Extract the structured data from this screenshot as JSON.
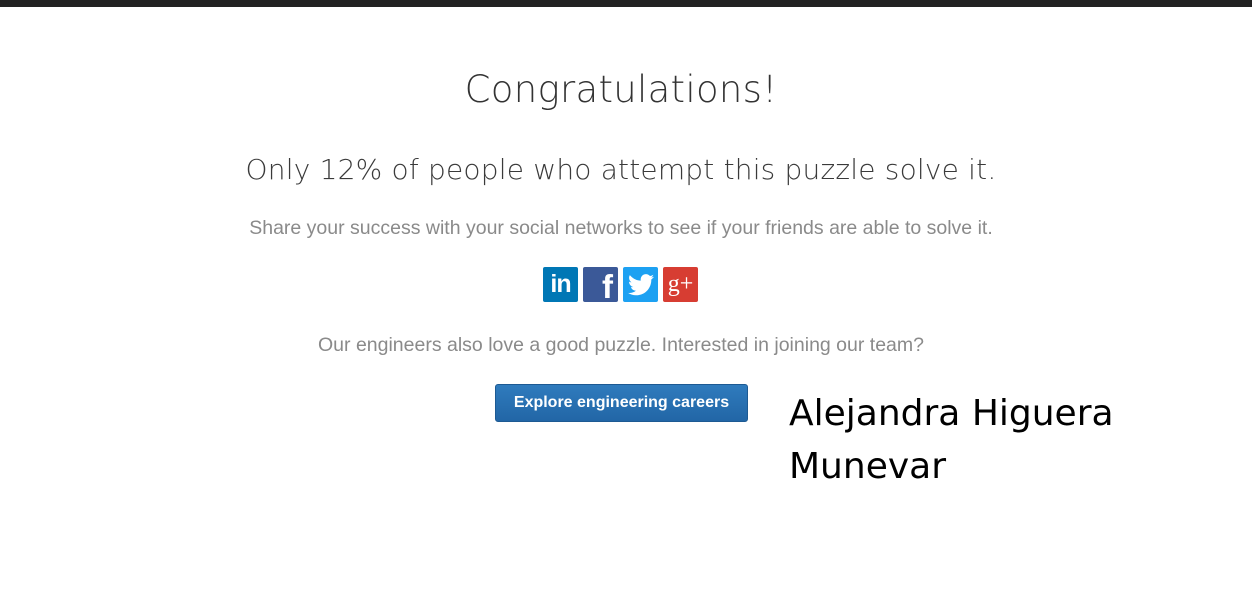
{
  "page": {
    "headline": "Congratulations!",
    "stat_text": "Only 12% of people who attempt this puzzle solve it.",
    "share_text": "Share your success with your social networks to see if your friends are able to solve it.",
    "join_text": "Our engineers also love a good puzzle. Interested in joining our team?",
    "careers_button": "Explore engineering careers"
  },
  "social": [
    {
      "name": "linkedin",
      "icon": "linkedin-icon",
      "glyph": "in",
      "color": "#0077b5"
    },
    {
      "name": "facebook",
      "icon": "facebook-icon",
      "glyph": "f",
      "color": "#3b5998"
    },
    {
      "name": "twitter",
      "icon": "twitter-icon",
      "glyph": "",
      "color": "#1da1f2"
    },
    {
      "name": "google-plus",
      "icon": "google-plus-icon",
      "glyph": "g+",
      "color": "#d73d32"
    }
  ],
  "annotation": {
    "name_line1": "Alejandra Higuera",
    "name_line2": "Munevar"
  },
  "colors": {
    "top_bar": "#222222",
    "button": "#2a70b0",
    "muted_text": "#8a8a8a"
  }
}
